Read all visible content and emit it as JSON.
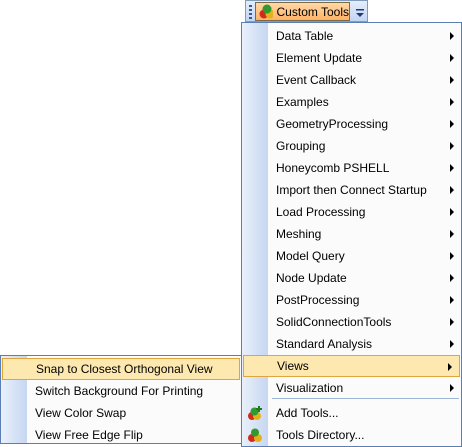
{
  "toolbar": {
    "button_label": "Custom Tools",
    "button_icon": "custom-tools-icon",
    "dropdown_icon": "chevron-down-icon"
  },
  "menu": {
    "items": [
      {
        "label": "Data Table",
        "submenu": true
      },
      {
        "label": "Element Update",
        "submenu": true
      },
      {
        "label": "Event Callback",
        "submenu": true
      },
      {
        "label": "Examples",
        "submenu": true
      },
      {
        "label": "GeometryProcessing",
        "submenu": true
      },
      {
        "label": "Grouping",
        "submenu": true
      },
      {
        "label": "Honeycomb PSHELL",
        "submenu": true
      },
      {
        "label": "Import then Connect Startup",
        "submenu": true
      },
      {
        "label": "Load Processing",
        "submenu": true
      },
      {
        "label": "Meshing",
        "submenu": true
      },
      {
        "label": "Model Query",
        "submenu": true
      },
      {
        "label": "Node Update",
        "submenu": true
      },
      {
        "label": "PostProcessing",
        "submenu": true
      },
      {
        "label": "SolidConnectionTools",
        "submenu": true
      },
      {
        "label": "Standard Analysis",
        "submenu": true
      },
      {
        "label": "Views",
        "submenu": true,
        "highlighted": true
      },
      {
        "label": "Visualization",
        "submenu": true
      }
    ],
    "footer_items": [
      {
        "label": "Add Tools...",
        "icon": "add-tools-icon"
      },
      {
        "label": "Tools Directory...",
        "icon": "tools-directory-icon"
      }
    ]
  },
  "views_submenu": {
    "items": [
      {
        "label": "Snap to Closest Orthogonal View",
        "highlighted": true
      },
      {
        "label": "Switch Background For Printing"
      },
      {
        "label": "View Color Swap"
      },
      {
        "label": "View Free Edge Flip"
      }
    ]
  },
  "colors": {
    "highlight_fill": "#fde8b0",
    "highlight_border": "#e0a53c",
    "menu_border": "#5a7fb5"
  }
}
